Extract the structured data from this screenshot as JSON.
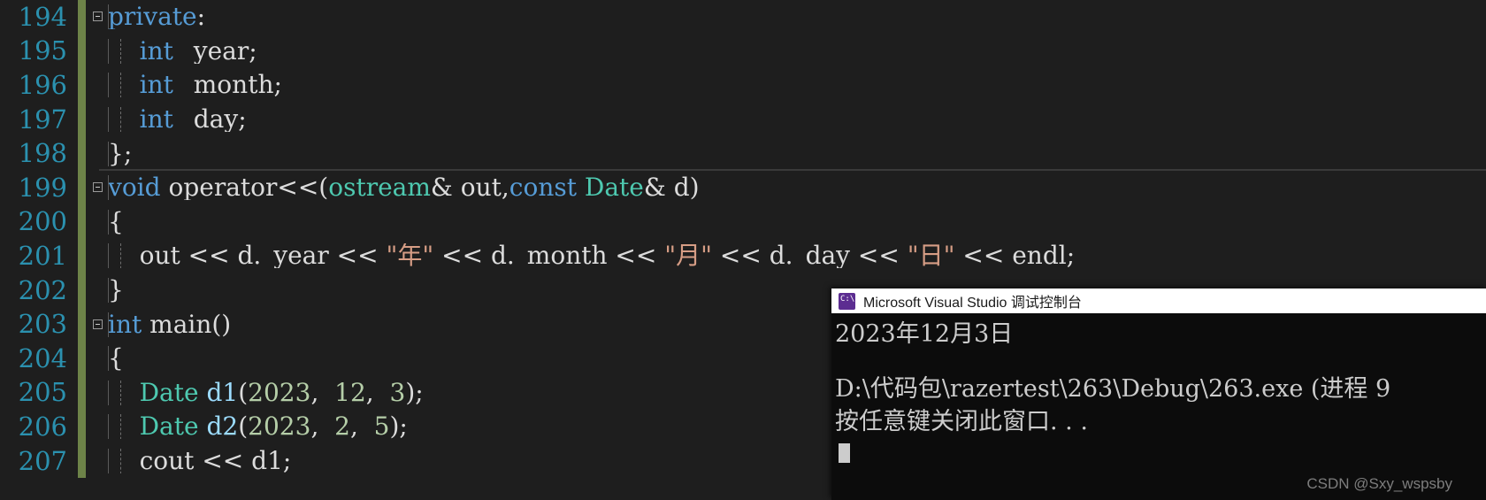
{
  "editor": {
    "lines": [
      {
        "number": "194",
        "fold": "collapse-minus",
        "has_changebar": true,
        "indent_guides": [],
        "tokens": [
          {
            "text": "private",
            "color": "t-key"
          },
          {
            "text": ":",
            "color": "t-punct"
          }
        ]
      },
      {
        "number": "195",
        "fold": "",
        "has_changebar": true,
        "indent_guides": [
          0
        ],
        "tokens": [
          {
            "text": "    ",
            "color": "t-plain"
          },
          {
            "text": "int",
            "color": "t-key"
          },
          {
            "text": " _year;",
            "color": "t-plain"
          }
        ]
      },
      {
        "number": "196",
        "fold": "",
        "has_changebar": true,
        "indent_guides": [
          0
        ],
        "tokens": [
          {
            "text": "    ",
            "color": "t-plain"
          },
          {
            "text": "int",
            "color": "t-key"
          },
          {
            "text": " _month;",
            "color": "t-plain"
          }
        ]
      },
      {
        "number": "197",
        "fold": "",
        "has_changebar": true,
        "indent_guides": [
          0
        ],
        "tokens": [
          {
            "text": "    ",
            "color": "t-plain"
          },
          {
            "text": "int",
            "color": "t-key"
          },
          {
            "text": " _day;",
            "color": "t-plain"
          }
        ]
      },
      {
        "number": "198",
        "fold": "",
        "has_changebar": true,
        "indent_guides": [],
        "tokens": [
          {
            "text": "};",
            "color": "t-plain"
          }
        ]
      },
      {
        "number": "199",
        "fold": "collapse-minus",
        "has_changebar": true,
        "indent_guides": [],
        "tokens": [
          {
            "text": "void",
            "color": "t-key"
          },
          {
            "text": " operator<<(",
            "color": "t-plain"
          },
          {
            "text": "ostream",
            "color": "t-type"
          },
          {
            "text": "& out,",
            "color": "t-plain"
          },
          {
            "text": "const",
            "color": "t-key"
          },
          {
            "text": " ",
            "color": "t-plain"
          },
          {
            "text": "Date",
            "color": "t-type"
          },
          {
            "text": "& d)",
            "color": "t-plain"
          }
        ]
      },
      {
        "number": "200",
        "fold": "",
        "has_changebar": true,
        "indent_guides": [],
        "tokens": [
          {
            "text": "{",
            "color": "t-plain"
          }
        ]
      },
      {
        "number": "201",
        "fold": "",
        "has_changebar": true,
        "indent_guides": [
          0
        ],
        "tokens": [
          {
            "text": "    out << d._year << ",
            "color": "t-plain"
          },
          {
            "text": "\"年\"",
            "color": "t-str"
          },
          {
            "text": " << d._month << ",
            "color": "t-plain"
          },
          {
            "text": "\"月\"",
            "color": "t-str"
          },
          {
            "text": " << d._day << ",
            "color": "t-plain"
          },
          {
            "text": "\"日\"",
            "color": "t-str"
          },
          {
            "text": " << endl;",
            "color": "t-plain"
          }
        ]
      },
      {
        "number": "202",
        "fold": "",
        "has_changebar": true,
        "indent_guides": [],
        "tokens": [
          {
            "text": "}",
            "color": "t-plain"
          }
        ]
      },
      {
        "number": "203",
        "fold": "collapse-minus",
        "has_changebar": true,
        "indent_guides": [],
        "tokens": [
          {
            "text": "int",
            "color": "t-key"
          },
          {
            "text": " main()",
            "color": "t-plain"
          }
        ]
      },
      {
        "number": "204",
        "fold": "",
        "has_changebar": true,
        "indent_guides": [],
        "tokens": [
          {
            "text": "{",
            "color": "t-plain"
          }
        ]
      },
      {
        "number": "205",
        "fold": "",
        "has_changebar": true,
        "indent_guides": [
          0
        ],
        "tokens": [
          {
            "text": "    ",
            "color": "t-plain"
          },
          {
            "text": "Date",
            "color": "t-type"
          },
          {
            "text": " ",
            "color": "t-plain"
          },
          {
            "text": "d1",
            "color": "t-var"
          },
          {
            "text": "(",
            "color": "t-plain"
          },
          {
            "text": "2023",
            "color": "t-num"
          },
          {
            "text": ", ",
            "color": "t-plain"
          },
          {
            "text": " 12",
            "color": "t-num"
          },
          {
            "text": ", ",
            "color": "t-plain"
          },
          {
            "text": " 3",
            "color": "t-num"
          },
          {
            "text": ");",
            "color": "t-plain"
          }
        ]
      },
      {
        "number": "206",
        "fold": "",
        "has_changebar": true,
        "indent_guides": [
          0
        ],
        "tokens": [
          {
            "text": "    ",
            "color": "t-plain"
          },
          {
            "text": "Date",
            "color": "t-type"
          },
          {
            "text": " ",
            "color": "t-plain"
          },
          {
            "text": "d2",
            "color": "t-var"
          },
          {
            "text": "(",
            "color": "t-plain"
          },
          {
            "text": "2023",
            "color": "t-num"
          },
          {
            "text": ", ",
            "color": "t-plain"
          },
          {
            "text": " 2",
            "color": "t-num"
          },
          {
            "text": ", ",
            "color": "t-plain"
          },
          {
            "text": " 5",
            "color": "t-num"
          },
          {
            "text": ");",
            "color": "t-plain"
          }
        ]
      },
      {
        "number": "207",
        "fold": "",
        "has_changebar": true,
        "indent_guides": [
          0
        ],
        "tokens": [
          {
            "text": "    cout << d1;",
            "color": "t-plain"
          }
        ]
      }
    ]
  },
  "console": {
    "title": "Microsoft Visual Studio 调试控制台",
    "icon": "cmd-icon",
    "output_line_1": "2023年12月3日",
    "output_line_2": "D:\\代码包\\razertest\\263\\Debug\\263.exe (进程 9",
    "output_line_3": "按任意键关闭此窗口. . ."
  },
  "watermark": {
    "text": "CSDN @Sxy_wspsby"
  }
}
